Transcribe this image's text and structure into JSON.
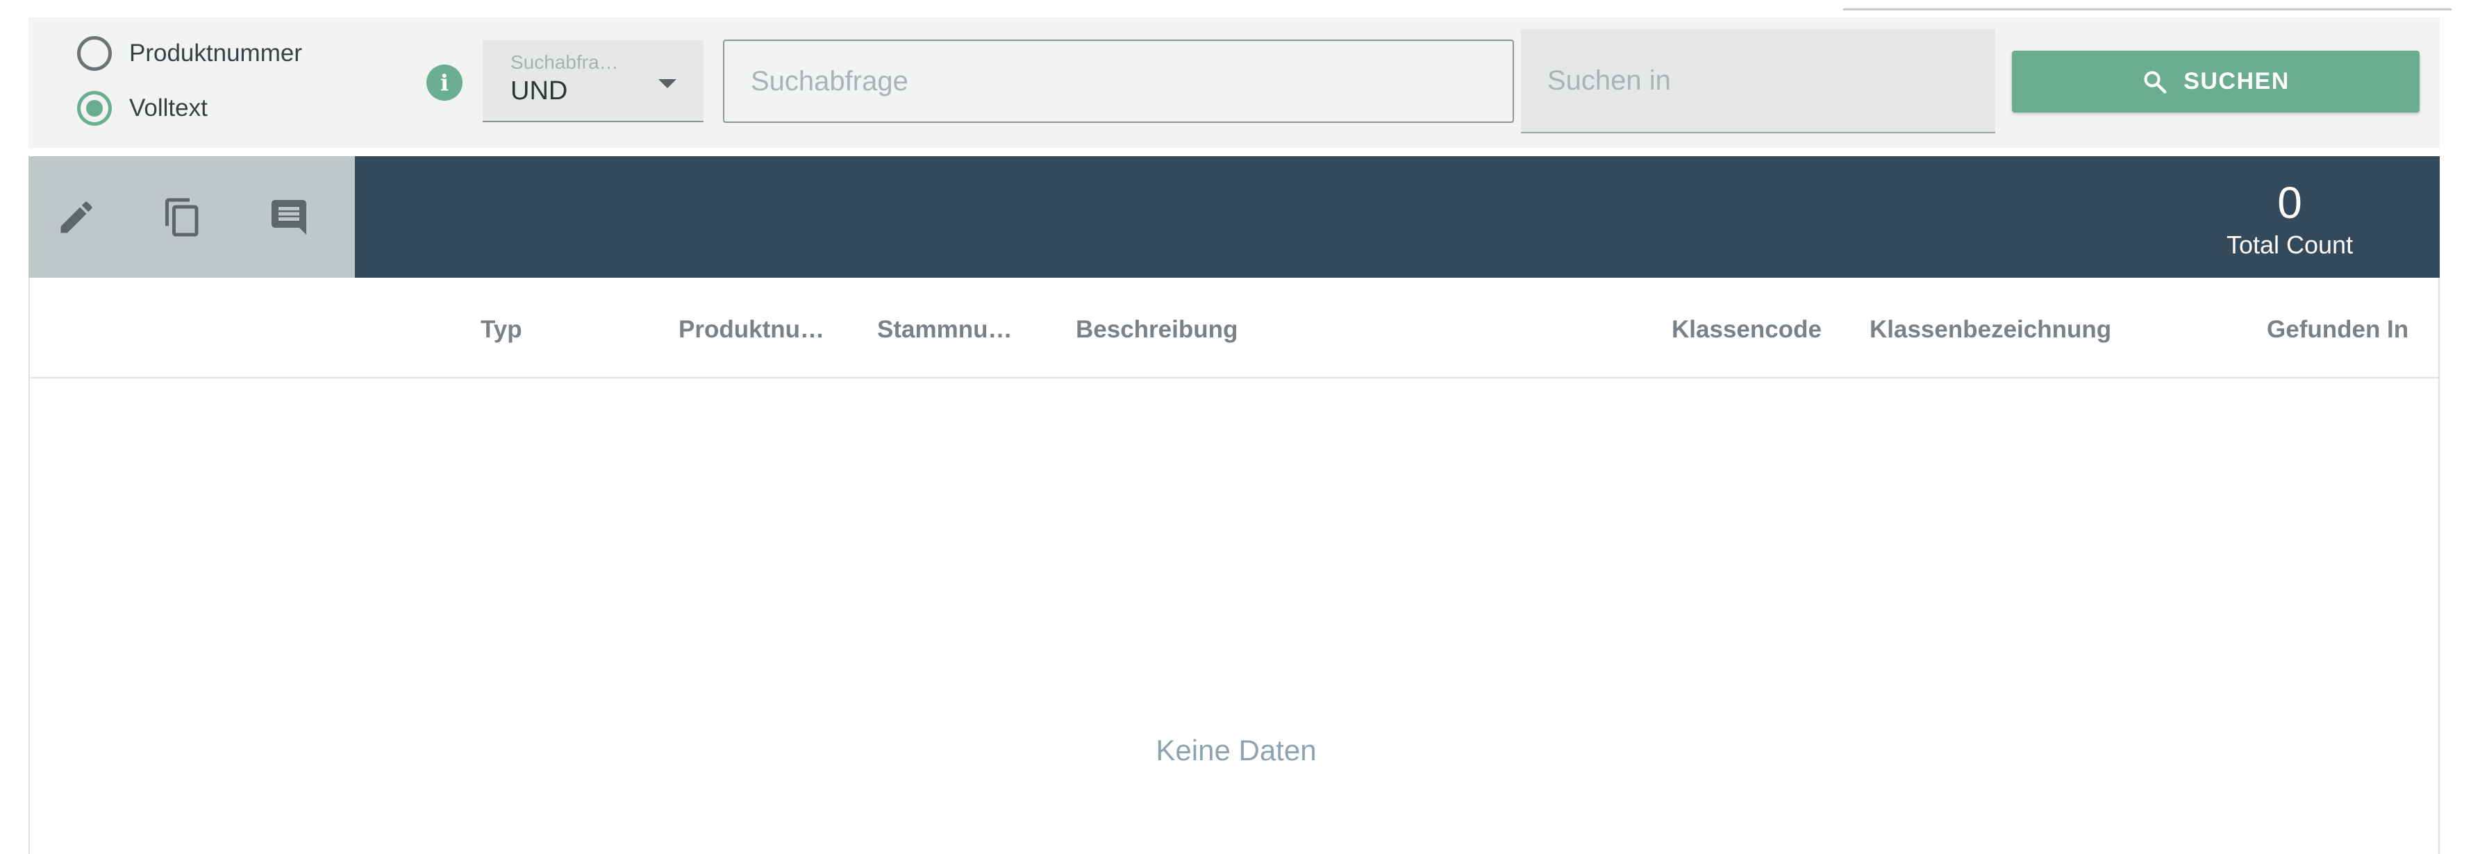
{
  "search": {
    "radio_options": [
      {
        "label": "Produktnummer",
        "checked": false
      },
      {
        "label": "Volltext",
        "checked": true
      }
    ],
    "operator_select": {
      "label": "Suchabfra…",
      "value": "UND"
    },
    "query_placeholder": "Suchabfrage",
    "scope_placeholder": "Suchen in",
    "button_label": "SUCHEN",
    "accent_color": "#6aad91"
  },
  "toolbar": {
    "icons": [
      "edit-icon",
      "copy-icon",
      "comment-icon"
    ],
    "total_count": "0",
    "total_count_label": "Total Count",
    "bar_color": "#344a5a"
  },
  "table": {
    "columns": [
      "Typ",
      "Produktnu…",
      "Stammnu…",
      "Beschreibung",
      "Klassencode",
      "Klassenbezeichnung",
      "Gefunden In"
    ],
    "rows": [],
    "empty_message": "Keine Daten"
  }
}
